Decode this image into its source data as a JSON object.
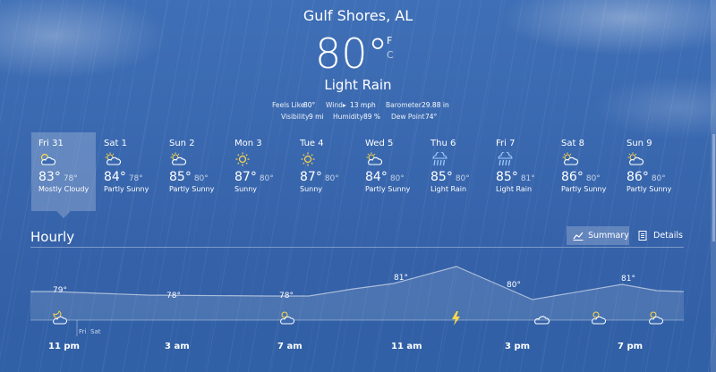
{
  "location": "Gulf Shores, AL",
  "current": {
    "temp": "80",
    "degree": "°",
    "unit_f": "F",
    "unit_c": "C",
    "condition": "Light Rain",
    "feels_like_label": "Feels Like",
    "feels_like": "80°",
    "wind_label": "Wind",
    "wind": "13 mph",
    "barometer_label": "Barometer",
    "barometer": "29.88 in",
    "visibility_label": "Visibility",
    "visibility": "9 mi",
    "humidity_label": "Humidity",
    "humidity": "89 %",
    "dewpoint_label": "Dew Point",
    "dewpoint": "74°"
  },
  "daily": [
    {
      "day": "Fri 31",
      "hi": "83°",
      "lo": "78°",
      "cond": "Mostly Cloudy",
      "icon": "partly-cloudy-icon"
    },
    {
      "day": "Sat 1",
      "hi": "84°",
      "lo": "78°",
      "cond": "Partly Sunny",
      "icon": "partly-sunny-icon"
    },
    {
      "day": "Sun 2",
      "hi": "85°",
      "lo": "80°",
      "cond": "Partly Sunny",
      "icon": "partly-sunny-icon"
    },
    {
      "day": "Mon 3",
      "hi": "87°",
      "lo": "80°",
      "cond": "Sunny",
      "icon": "sun-icon"
    },
    {
      "day": "Tue 4",
      "hi": "87°",
      "lo": "80°",
      "cond": "Sunny",
      "icon": "sun-icon"
    },
    {
      "day": "Wed 5",
      "hi": "84°",
      "lo": "80°",
      "cond": "Partly Sunny",
      "icon": "partly-sunny-icon"
    },
    {
      "day": "Thu 6",
      "hi": "85°",
      "lo": "80°",
      "cond": "Light Rain",
      "icon": "rain-icon"
    },
    {
      "day": "Fri 7",
      "hi": "85°",
      "lo": "81°",
      "cond": "Light Rain",
      "icon": "rain-icon"
    },
    {
      "day": "Sat 8",
      "hi": "86°",
      "lo": "80°",
      "cond": "Partly Sunny",
      "icon": "partly-sunny-icon"
    },
    {
      "day": "Sun 9",
      "hi": "86°",
      "lo": "80°",
      "cond": "Partly Sunny",
      "icon": "partly-sunny-icon"
    }
  ],
  "hourly": {
    "title": "Hourly",
    "summary_label": "Summary",
    "details_label": "Details",
    "day_labels": [
      "Fri",
      "Sat"
    ],
    "time_labels": [
      "11 pm",
      "3 am",
      "7 am",
      "11 am",
      "3 pm",
      "7 pm"
    ],
    "temp_labels": [
      "79°",
      "78°",
      "78°",
      "81°",
      "80°",
      "81°"
    ],
    "icons": [
      "partly-cloudy-night-icon",
      "partly-sunny-icon",
      "thunder-icon",
      "cloudy-icon",
      "partly-sunny-icon",
      "partly-sunny-icon"
    ]
  },
  "colors": {
    "accent": "#ffd84a",
    "rain": "#9fd0ff",
    "background": "#3a69b0"
  }
}
